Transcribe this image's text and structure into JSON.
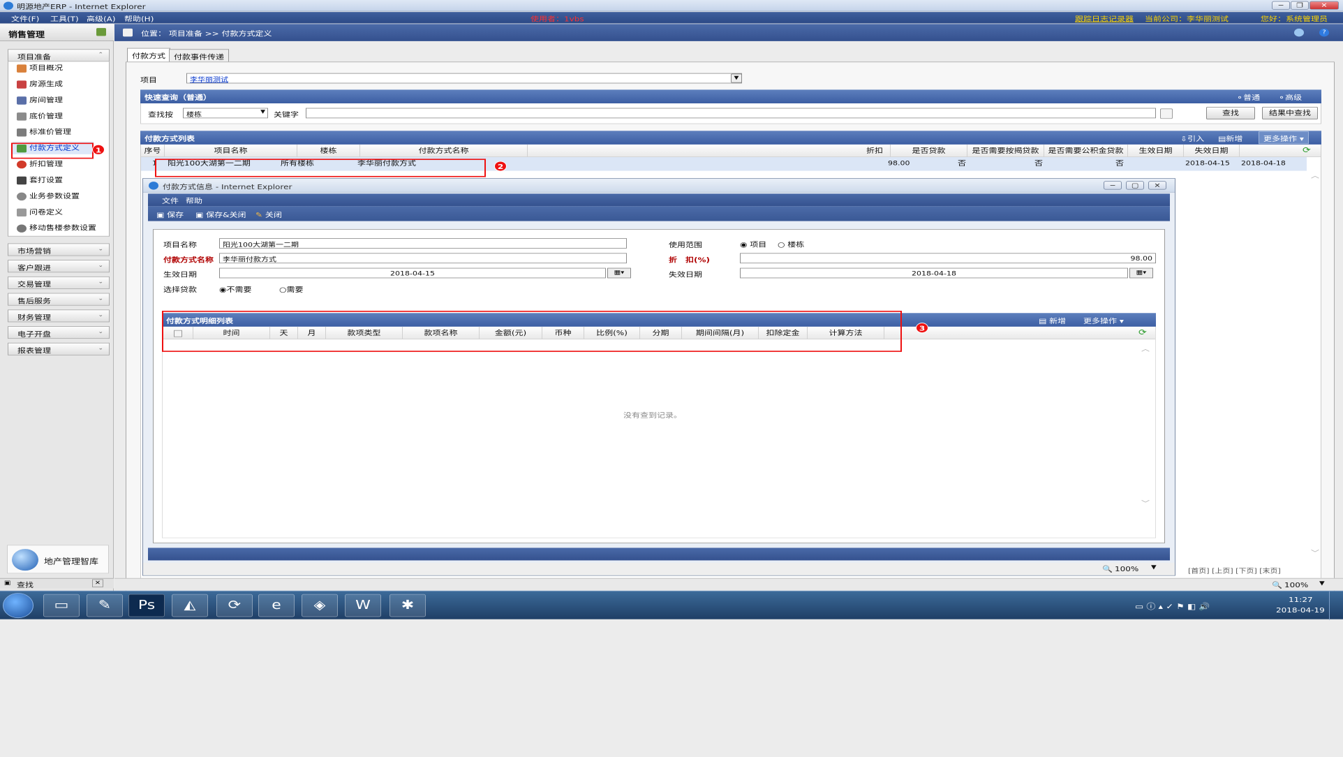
{
  "window": {
    "title": "明源地产ERP - Internet Explorer"
  },
  "menubar": {
    "items": [
      "文件(F)",
      "工具(T)",
      "高级(A)",
      "帮助(H)"
    ],
    "user": "使用者：1vbs",
    "log_link": "跟踪日志记录器",
    "company": "当前公司：李华丽测试",
    "greeting": "您好：系统管理员"
  },
  "sidebar": {
    "title": "销售管理",
    "group_open": "项目准备",
    "items": [
      "项目概况",
      "房源生成",
      "房间管理",
      "底价管理",
      "标准价管理",
      "付款方式定义",
      "折扣管理",
      "套打设置",
      "业务参数设置",
      "问卷定义",
      "移动售楼参数设置"
    ],
    "groups": [
      "市场营销",
      "客户跟进",
      "交易管理",
      "售后服务",
      "财务管理",
      "电子开盘",
      "报表管理"
    ],
    "logo_text": "地产管理智库",
    "find": "查找"
  },
  "breadcrumb": {
    "text": "位置： 项目准备 >> 付款方式定义"
  },
  "tabs": [
    "付款方式",
    "付款事件传递"
  ],
  "project": {
    "label": "项目",
    "value": "李华丽测试"
  },
  "quick": {
    "title": "快速查询（普通）",
    "normal": "普通",
    "advanced": "高级",
    "by_label": "查找按",
    "by_value": "楼栋",
    "keyword_label": "关键字",
    "search": "查找",
    "search_in": "结果中查找"
  },
  "list": {
    "title": "付款方式列表",
    "import": "引入",
    "add": "新增",
    "more": "更多操作",
    "headers": [
      "序号",
      "项目名称",
      "楼栋",
      "付款方式名称",
      "折扣",
      "是否贷款",
      "是否需要按揭贷款",
      "是否需要公积金贷款",
      "生效日期",
      "失效日期"
    ],
    "row": [
      "1",
      "阳光100大湖第一二期",
      "所有楼栋",
      "李华丽付款方式",
      "98.00",
      "否",
      "否",
      "否",
      "2018-04-15",
      "2018-04-18"
    ],
    "pager": "[首页] [上页] [下页] [末页]"
  },
  "dialog": {
    "title": "付款方式信息 - Internet Explorer",
    "menu": [
      "文件",
      "帮助"
    ],
    "toolbar": [
      "保存",
      "保存&关闭",
      "关闭"
    ],
    "form": {
      "project_name_label": "项目名称",
      "project_name": "阳光100大湖第一二期",
      "scope_label": "使用范围",
      "scope_opt1": "项目",
      "scope_opt2": "楼栋",
      "pay_name_label": "付款方式名称",
      "pay_name": "李华丽付款方式",
      "discount_label": "折　扣(%)",
      "discount": "98.00",
      "start_label": "生效日期",
      "start": "2018-04-15",
      "end_label": "失效日期",
      "end": "2018-04-18",
      "loan_label": "选择贷款",
      "loan_opt1": "不需要",
      "loan_opt2": "需要"
    },
    "detail": {
      "title": "付款方式明细列表",
      "add": "新增",
      "more": "更多操作",
      "headers": [
        "时间",
        "天",
        "月",
        "款项类型",
        "款项名称",
        "金额(元)",
        "币种",
        "比例(%)",
        "分期",
        "期间间隔(月)",
        "扣除定金",
        "计算方法"
      ],
      "empty": "没有查到记录。"
    },
    "zoom": "100%"
  },
  "status": {
    "zoom": "100%"
  },
  "markers": [
    "1",
    "2",
    "3"
  ],
  "clock": {
    "time": "11:27",
    "date": "2018-04-19"
  }
}
